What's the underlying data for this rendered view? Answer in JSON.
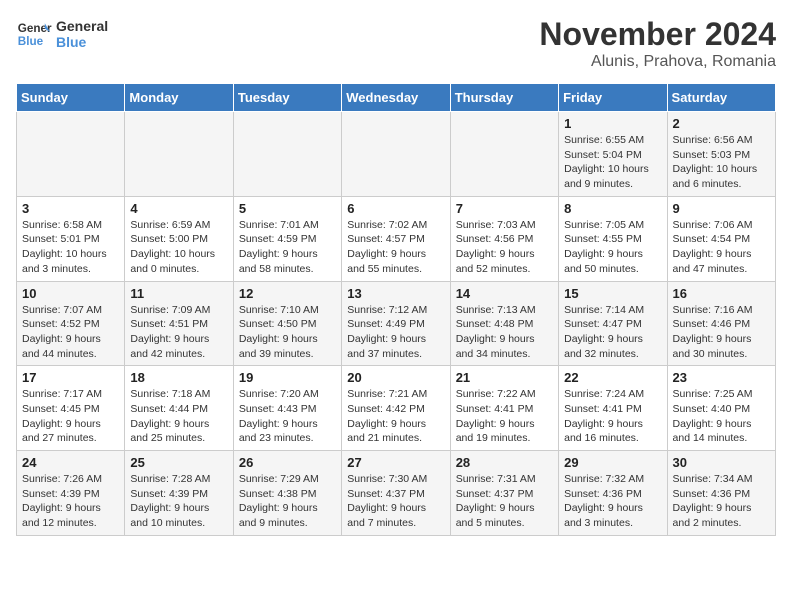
{
  "logo": {
    "line1": "General",
    "line2": "Blue"
  },
  "title": "November 2024",
  "location": "Alunis, Prahova, Romania",
  "weekdays": [
    "Sunday",
    "Monday",
    "Tuesday",
    "Wednesday",
    "Thursday",
    "Friday",
    "Saturday"
  ],
  "weeks": [
    [
      {
        "day": "",
        "info": ""
      },
      {
        "day": "",
        "info": ""
      },
      {
        "day": "",
        "info": ""
      },
      {
        "day": "",
        "info": ""
      },
      {
        "day": "",
        "info": ""
      },
      {
        "day": "1",
        "info": "Sunrise: 6:55 AM\nSunset: 5:04 PM\nDaylight: 10 hours and 9 minutes."
      },
      {
        "day": "2",
        "info": "Sunrise: 6:56 AM\nSunset: 5:03 PM\nDaylight: 10 hours and 6 minutes."
      }
    ],
    [
      {
        "day": "3",
        "info": "Sunrise: 6:58 AM\nSunset: 5:01 PM\nDaylight: 10 hours and 3 minutes."
      },
      {
        "day": "4",
        "info": "Sunrise: 6:59 AM\nSunset: 5:00 PM\nDaylight: 10 hours and 0 minutes."
      },
      {
        "day": "5",
        "info": "Sunrise: 7:01 AM\nSunset: 4:59 PM\nDaylight: 9 hours and 58 minutes."
      },
      {
        "day": "6",
        "info": "Sunrise: 7:02 AM\nSunset: 4:57 PM\nDaylight: 9 hours and 55 minutes."
      },
      {
        "day": "7",
        "info": "Sunrise: 7:03 AM\nSunset: 4:56 PM\nDaylight: 9 hours and 52 minutes."
      },
      {
        "day": "8",
        "info": "Sunrise: 7:05 AM\nSunset: 4:55 PM\nDaylight: 9 hours and 50 minutes."
      },
      {
        "day": "9",
        "info": "Sunrise: 7:06 AM\nSunset: 4:54 PM\nDaylight: 9 hours and 47 minutes."
      }
    ],
    [
      {
        "day": "10",
        "info": "Sunrise: 7:07 AM\nSunset: 4:52 PM\nDaylight: 9 hours and 44 minutes."
      },
      {
        "day": "11",
        "info": "Sunrise: 7:09 AM\nSunset: 4:51 PM\nDaylight: 9 hours and 42 minutes."
      },
      {
        "day": "12",
        "info": "Sunrise: 7:10 AM\nSunset: 4:50 PM\nDaylight: 9 hours and 39 minutes."
      },
      {
        "day": "13",
        "info": "Sunrise: 7:12 AM\nSunset: 4:49 PM\nDaylight: 9 hours and 37 minutes."
      },
      {
        "day": "14",
        "info": "Sunrise: 7:13 AM\nSunset: 4:48 PM\nDaylight: 9 hours and 34 minutes."
      },
      {
        "day": "15",
        "info": "Sunrise: 7:14 AM\nSunset: 4:47 PM\nDaylight: 9 hours and 32 minutes."
      },
      {
        "day": "16",
        "info": "Sunrise: 7:16 AM\nSunset: 4:46 PM\nDaylight: 9 hours and 30 minutes."
      }
    ],
    [
      {
        "day": "17",
        "info": "Sunrise: 7:17 AM\nSunset: 4:45 PM\nDaylight: 9 hours and 27 minutes."
      },
      {
        "day": "18",
        "info": "Sunrise: 7:18 AM\nSunset: 4:44 PM\nDaylight: 9 hours and 25 minutes."
      },
      {
        "day": "19",
        "info": "Sunrise: 7:20 AM\nSunset: 4:43 PM\nDaylight: 9 hours and 23 minutes."
      },
      {
        "day": "20",
        "info": "Sunrise: 7:21 AM\nSunset: 4:42 PM\nDaylight: 9 hours and 21 minutes."
      },
      {
        "day": "21",
        "info": "Sunrise: 7:22 AM\nSunset: 4:41 PM\nDaylight: 9 hours and 19 minutes."
      },
      {
        "day": "22",
        "info": "Sunrise: 7:24 AM\nSunset: 4:41 PM\nDaylight: 9 hours and 16 minutes."
      },
      {
        "day": "23",
        "info": "Sunrise: 7:25 AM\nSunset: 4:40 PM\nDaylight: 9 hours and 14 minutes."
      }
    ],
    [
      {
        "day": "24",
        "info": "Sunrise: 7:26 AM\nSunset: 4:39 PM\nDaylight: 9 hours and 12 minutes."
      },
      {
        "day": "25",
        "info": "Sunrise: 7:28 AM\nSunset: 4:39 PM\nDaylight: 9 hours and 10 minutes."
      },
      {
        "day": "26",
        "info": "Sunrise: 7:29 AM\nSunset: 4:38 PM\nDaylight: 9 hours and 9 minutes."
      },
      {
        "day": "27",
        "info": "Sunrise: 7:30 AM\nSunset: 4:37 PM\nDaylight: 9 hours and 7 minutes."
      },
      {
        "day": "28",
        "info": "Sunrise: 7:31 AM\nSunset: 4:37 PM\nDaylight: 9 hours and 5 minutes."
      },
      {
        "day": "29",
        "info": "Sunrise: 7:32 AM\nSunset: 4:36 PM\nDaylight: 9 hours and 3 minutes."
      },
      {
        "day": "30",
        "info": "Sunrise: 7:34 AM\nSunset: 4:36 PM\nDaylight: 9 hours and 2 minutes."
      }
    ]
  ]
}
